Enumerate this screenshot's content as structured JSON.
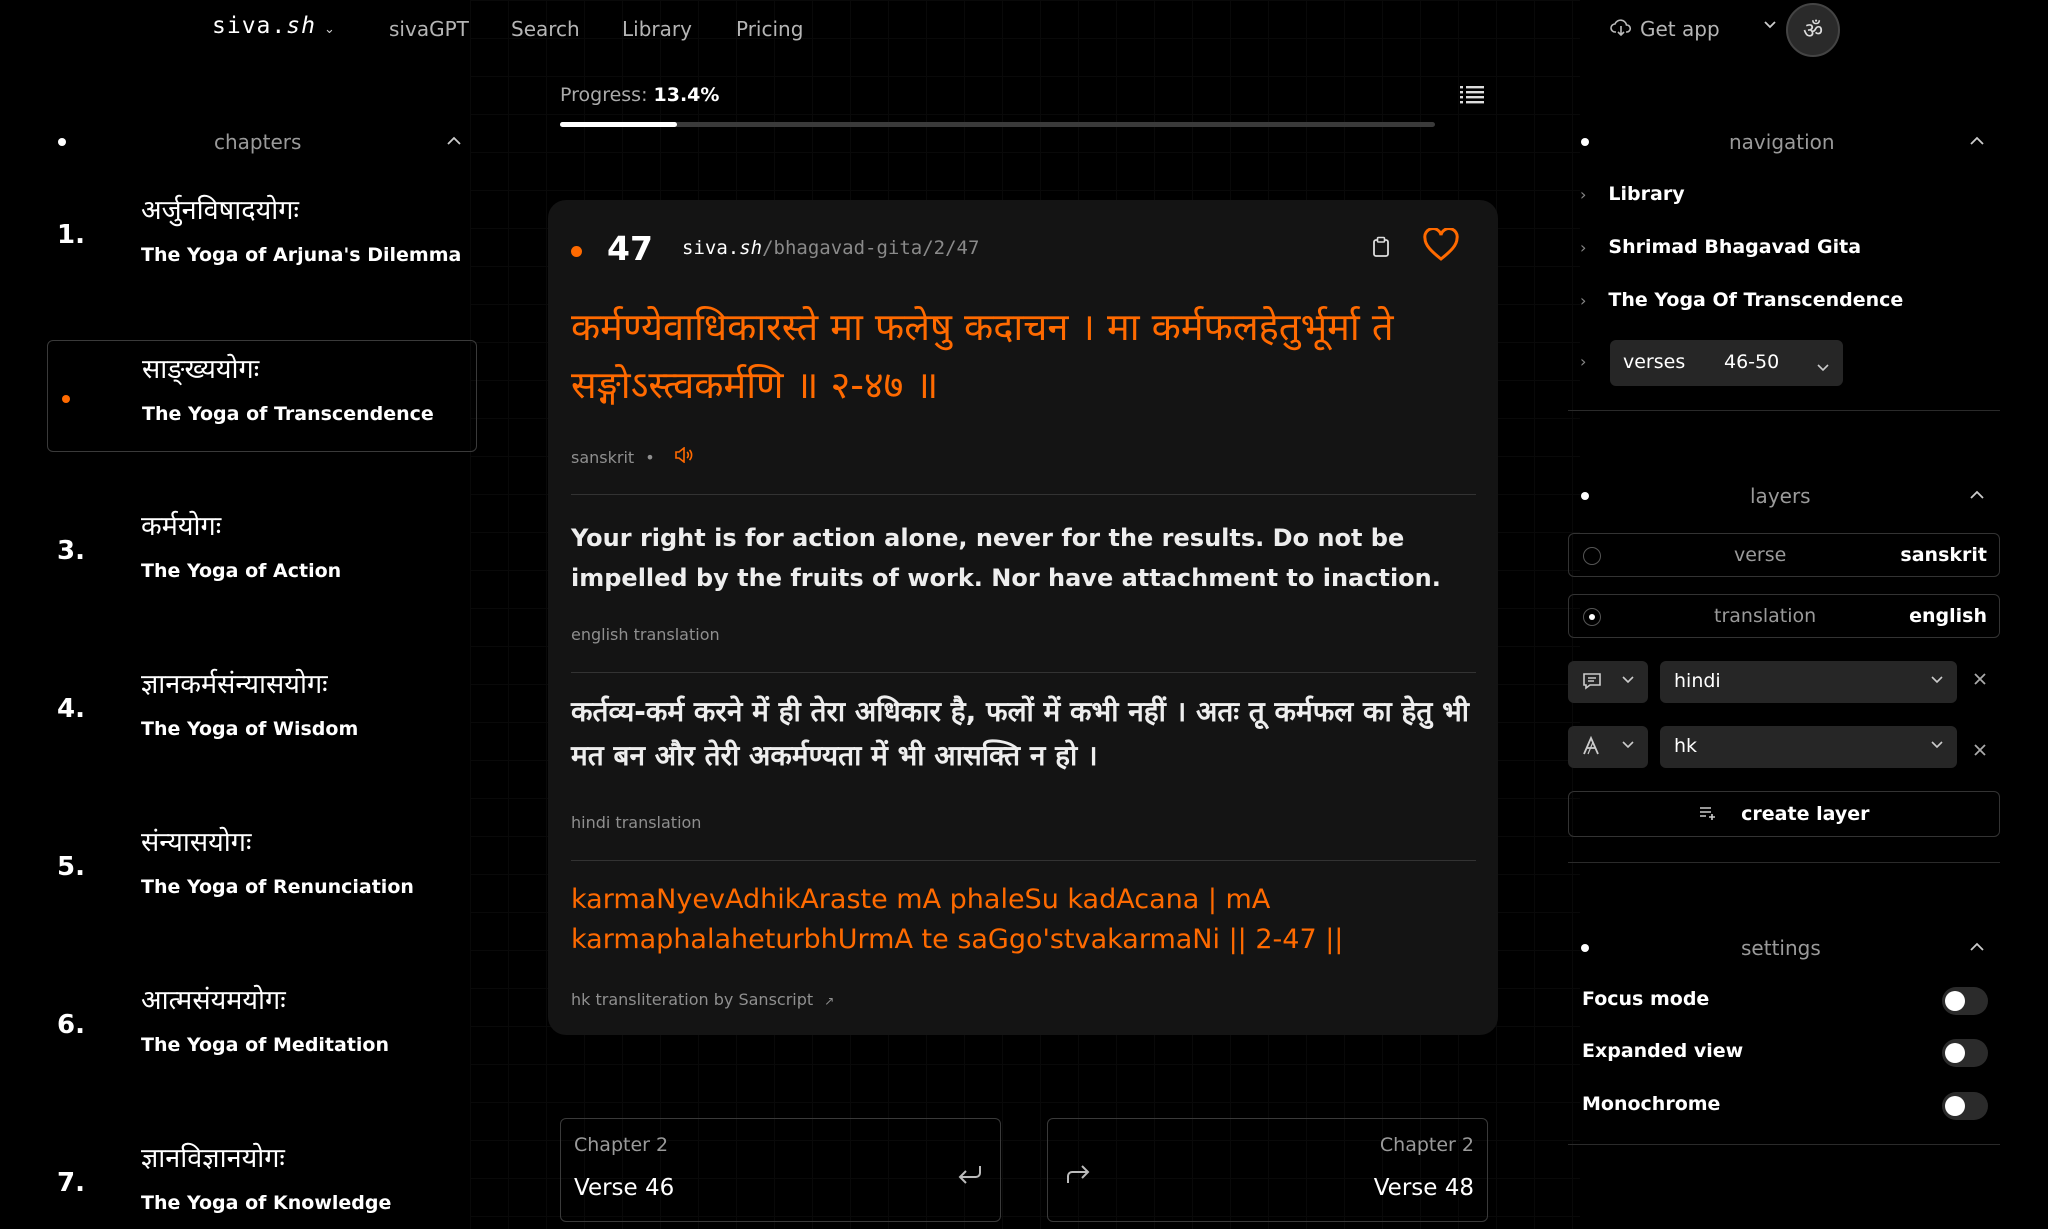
{
  "app": {
    "brand_prefix": "siva.",
    "brand_suffix": "sh",
    "brand_chevron": "⌄"
  },
  "topnav": {
    "links": [
      "sivaGPT",
      "Search",
      "Library",
      "Pricing"
    ],
    "get_app": "Get app",
    "avatar_glyph": "ॐ"
  },
  "progress": {
    "label": "Progress:",
    "value_text": "13.4%",
    "fraction": 0.134
  },
  "chapters": {
    "title": "chapters",
    "items": [
      {
        "num": "1.",
        "sanskrit": "अर्जुनविषादयोगः",
        "english": "The Yoga of Arjuna's Dilemma",
        "active": false
      },
      {
        "num": "",
        "sanskrit": "साङ्ख्ययोगः",
        "english": "The Yoga of Transcendence",
        "active": true
      },
      {
        "num": "3.",
        "sanskrit": "कर्मयोगः",
        "english": "The Yoga of Action",
        "active": false
      },
      {
        "num": "4.",
        "sanskrit": "ज्ञानकर्मसंन्यासयोगः",
        "english": "The Yoga of Wisdom",
        "active": false
      },
      {
        "num": "5.",
        "sanskrit": "संन्यासयोगः",
        "english": "The Yoga of Renunciation",
        "active": false
      },
      {
        "num": "6.",
        "sanskrit": "आत्मसंयमयोगः",
        "english": "The Yoga of Meditation",
        "active": false
      },
      {
        "num": "7.",
        "sanskrit": "ज्ञानविज्ञानयोगः",
        "english": "The Yoga of Knowledge",
        "active": false
      }
    ]
  },
  "verse": {
    "number": "47",
    "path_brand_prefix": "siva.",
    "path_brand_suffix": "sh",
    "path_rest": "/bhagavad-gita/2/47",
    "sanskrit": "कर्मण्येवाधिकारस्ते मा फलेषु कदाचन  । मा कर्मफलहेतुर्भूर्मा ते सङ्गोऽस्त्वकर्मणि  ॥ २-४७  ॥",
    "sanskrit_label": "sanskrit",
    "sanskrit_sep": "•",
    "english": "Your right is for action alone, never for the results. Do not be impelled by the fruits of work. Nor have attachment to inaction.",
    "english_label": "english translation",
    "hindi": "कर्तव्य-कर्म करने में ही तेरा अधिकार है, फलों में कभी नहीं । अतः तू कर्मफल का हेतु भी मत बन और तेरी अकर्मण्यता में भी आसक्ति न हो ।",
    "hindi_label": "hindi translation",
    "translit": "karmaNyevAdhikAraste mA phaleSu kadAcana  | mA karmaphalaheturbhUrmA te saGgo'stvakarmaNi  || 2-47  ||",
    "translit_label": "hk transliteration by Sanscript",
    "translit_link_glyph": "↗"
  },
  "prev": {
    "chapter": "Chapter 2",
    "verse": "Verse 46"
  },
  "next": {
    "chapter": "Chapter 2",
    "verse": "Verse 48"
  },
  "navigation": {
    "title": "navigation",
    "items": [
      "Library",
      "Shrimad Bhagavad Gita",
      "The Yoga Of Transcendence"
    ],
    "verses_label": "verses",
    "verses_range": "46-50"
  },
  "layers": {
    "title": "layers",
    "rows": [
      {
        "label": "verse",
        "value": "sanskrit",
        "selected": false
      },
      {
        "label": "translation",
        "value": "english",
        "selected": true
      }
    ],
    "extra": [
      {
        "value": "hindi"
      },
      {
        "value": "hk"
      }
    ],
    "create": "create layer"
  },
  "settings": {
    "title": "settings",
    "items": [
      {
        "label": "Focus mode",
        "on": false
      },
      {
        "label": "Expanded view",
        "on": false
      },
      {
        "label": "Monochrome",
        "on": false
      }
    ]
  },
  "colors": {
    "accent": "#ff6a00",
    "bg": "#000000",
    "card": "#141414"
  }
}
